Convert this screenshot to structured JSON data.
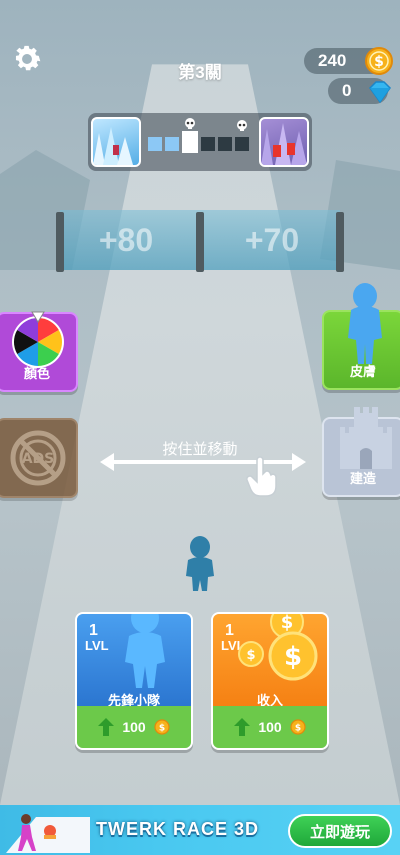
{
  "hud": {
    "level_title": "第3關",
    "coins": "240",
    "gems": "0",
    "settings_icon": "gear-icon",
    "coin_icon": "coin-icon",
    "gem_icon": "diamond-icon"
  },
  "progress": {
    "segments": [
      "done",
      "done",
      "current",
      "todo",
      "todo",
      "todo"
    ],
    "skull_icon": "skull-icon"
  },
  "gates": {
    "left": "+80",
    "right": "+70"
  },
  "side_buttons": {
    "color_label": "顏色",
    "skin_label": "皮膚",
    "build_label": "建造",
    "ads_label": "ADS"
  },
  "hint": {
    "text": "按住並移動"
  },
  "cards": {
    "vanguard": {
      "level": "1",
      "lvl": "LVL",
      "name": "先鋒小隊",
      "cost": "100"
    },
    "income": {
      "level": "1",
      "lvl": "LVL",
      "name": "收入",
      "cost": "100"
    }
  },
  "banner": {
    "title": "TWERK RACE 3D",
    "play_label": "立即遊玩"
  },
  "colors": {
    "accent_green": "#6cc94a",
    "blue_card": "#2a74cf",
    "orange_card": "#f57f12",
    "purple": "#b04ad8"
  }
}
